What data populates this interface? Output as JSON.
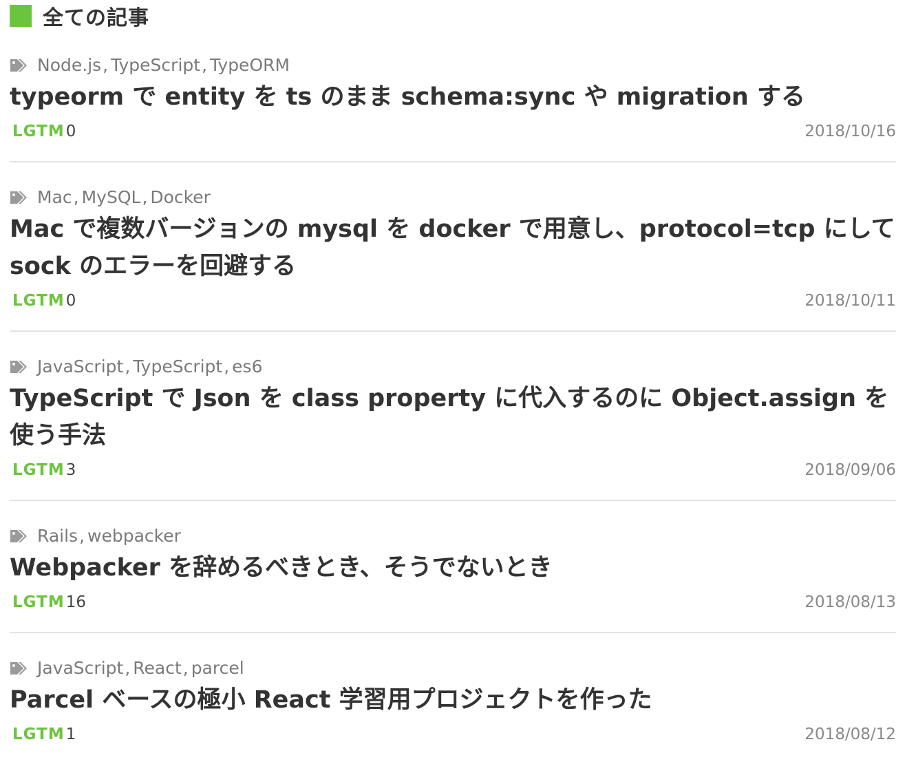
{
  "section": {
    "title": "全ての記事",
    "accent_color": "#6bc53c"
  },
  "lgtm_label": "LGTM",
  "articles": [
    {
      "tags": [
        "Node.js",
        "TypeScript",
        "TypeORM"
      ],
      "title": "typeorm で entity を ts のまま schema:sync や migration する",
      "lgtm": "0",
      "date": "2018/10/16"
    },
    {
      "tags": [
        "Mac",
        "MySQL",
        "Docker"
      ],
      "title": "Mac で複数バージョンの mysql を docker で用意し、protocol=tcp にして sock のエラーを回避する",
      "lgtm": "0",
      "date": "2018/10/11"
    },
    {
      "tags": [
        "JavaScript",
        "TypeScript",
        "es6"
      ],
      "title": "TypeScript で Json を class property に代入するのに Object.assign を使う手法",
      "lgtm": "3",
      "date": "2018/09/06"
    },
    {
      "tags": [
        "Rails",
        "webpacker"
      ],
      "title": "Webpacker を辞めるべきとき、そうでないとき",
      "lgtm": "16",
      "date": "2018/08/13"
    },
    {
      "tags": [
        "JavaScript",
        "React",
        "parcel"
      ],
      "title": "Parcel ベースの極小 React 学習用プロジェクトを作った",
      "lgtm": "1",
      "date": "2018/08/12"
    }
  ],
  "icons": {
    "tag": "tags-icon"
  }
}
